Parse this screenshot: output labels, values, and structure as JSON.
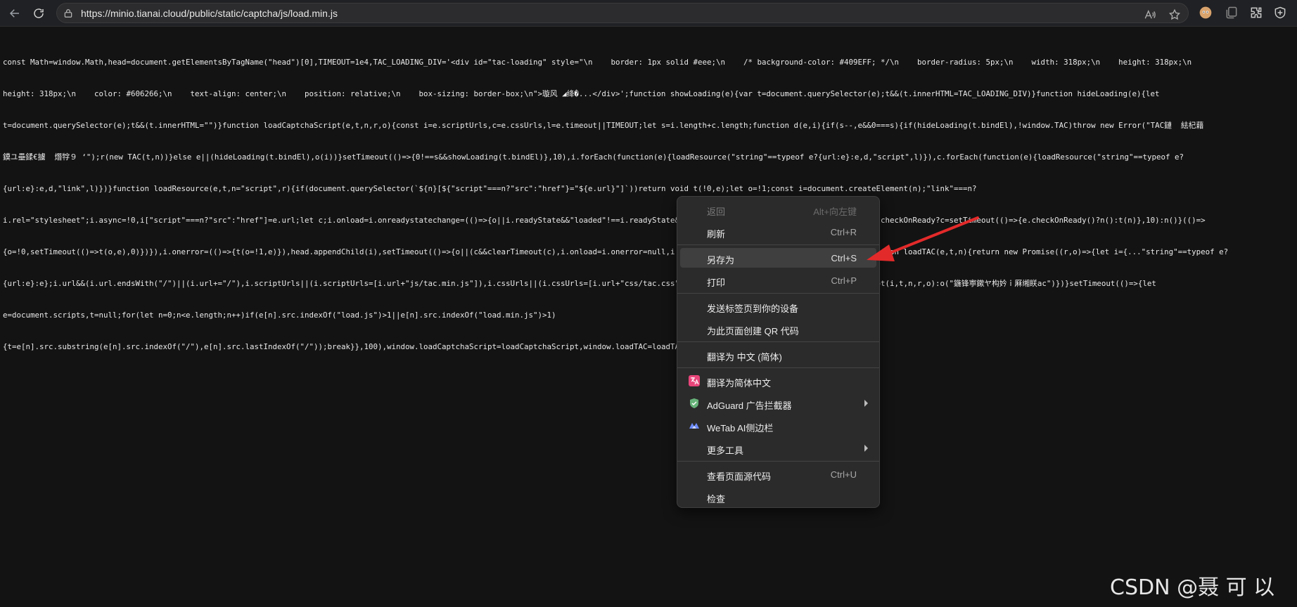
{
  "browser": {
    "url": "https://minio.tianai.cloud/public/static/captcha/js/load.min.js"
  },
  "code_lines": [
    "const Math=window.Math,head=document.getElementsByTagName(\"head\")[0],TIMEOUT=1e4,TAC_LOADING_DIV='<div id=\"tac-loading\" style=\"\\n    border: 1px solid #eee;\\n    /* background-color: #409EFF; */\\n    border-radius: 5px;\\n    width: 318px;\\n    height: 318px;\\n",
    "height: 318px;\\n    color: #606266;\\n    text-align: center;\\n    position: relative;\\n    box-sizing: border-box;\\n\">璇风 ◢绛�...</div>';function showLoading(e){var t=document.querySelector(e);t&&(t.innerHTML=TAC_LOADING_DIV)}function hideLoading(e){let",
    "t=document.querySelector(e);t&&(t.innerHTML=\"\")}function loadCaptchaScript(e,t,n,r,o){const i=e.scriptUrls,c=e.cssUrls,l=e.timeout||TIMEOUT;let s=i.length+c.length;function d(e,i){if(s--,e&&0===s){if(hideLoading(t.bindEl),!window.TAC)throw new Error(\"TAC鏈  紶杞藉",
    "鏌ユ壘鍒€擄  熸牸９ ‘\");r(new TAC(t,n))}else e||(hideLoading(t.bindEl),o(i))}setTimeout(()=>{0!==s&&showLoading(t.bindEl)},10),i.forEach(function(e){loadResource(\"string\"==typeof e?{url:e}:e,d,\"script\",l)}),c.forEach(function(e){loadResource(\"string\"==typeof e?",
    "{url:e}:e,d,\"link\",l)})}function loadResource(e,t,n=\"script\",r){if(document.querySelector(`${n}[${\"script\"===n?\"src\":\"href\"}=\"${e.url}\"]`))return void t(!0,e);let o=!1;const i=document.createElement(n);\"link\"===n?",
    "i.rel=\"stylesheet\";i.async=!0,i[\"script\"===n?\"src\":\"href\"]=e.url;let c;i.onload=i.onreadystatechange=(()=>{o||i.readyState&&\"loaded\"!==i.readyState&&\"complete\"!==i.readyState||function t(n){e.checkOnReady?c=setTimeout(()=>{e.checkOnReady()?n():t(n)},10):n()}(()=>",
    "{o=!0,setTimeout(()=>t(o,e),0)})}),i.onerror=(()=>{t(o=!1,e)}),head.appendChild(i),setTimeout(()=>{o||(c&&clearTimeout(c),i.onload=i.onerror=null,i.remove&&i.remove(),t(o,e))},r||TIMEOUT)}function loadTAC(e,t,n){return new Promise((r,o)=>{let i={...\"string\"==typeof e?",
    "{url:e}:e};i.url&&(i.url.endsWith(\"/\")||(i.url+=\"/\"),i.scriptUrls||(i.scriptUrls=[i.url+\"js/tac.min.js\"]),i.cssUrls||(i.cssUrls=[i.url+\"css/tac.css\"])),i.scriptUrls&&i.cssUrls?loadCaptchaScript(i,t,n,r,o):o(\"鍦锋寕鏉ヤ构妗ｉ厤缃眹ac\")})}setTimeout(()=>{let",
    "e=document.scripts,t=null;for(let n=0;n<e.length;n++)if(e[n].src.indexOf(\"load.js\")>1||e[n].src.indexOf(\"load.min.js\")>1)",
    "{t=e[n].src.substring(e[n].src.indexOf(\"/\"),e[n].src.lastIndexOf(\"/\"));break}},100),window.loadCaptchaScript=loadCaptchaScript,window.loadTAC=loadTAC,window.initTAC=loadTAC;"
  ],
  "menu": {
    "back": {
      "label": "返回",
      "shortcut": "Alt+向左键"
    },
    "refresh": {
      "label": "刷新",
      "shortcut": "Ctrl+R"
    },
    "save_as": {
      "label": "另存为",
      "shortcut": "Ctrl+S"
    },
    "print": {
      "label": "打印",
      "shortcut": "Ctrl+P"
    },
    "send_tab": {
      "label": "发送标签页到你的设备"
    },
    "qr_code": {
      "label": "为此页面创建 QR 代码"
    },
    "translate": {
      "label": "翻译为 中文 (简体)"
    },
    "translate_ext": {
      "label": "翻译为简体中文"
    },
    "adguard": {
      "label": "AdGuard 广告拦截器"
    },
    "wetab": {
      "label": "WeTab AI侧边栏"
    },
    "more_tools": {
      "label": "更多工具"
    },
    "view_source": {
      "label": "查看页面源代码",
      "shortcut": "Ctrl+U"
    },
    "inspect": {
      "label": "检查"
    }
  },
  "watermark": "CSDN @聂 可 以",
  "colors": {
    "arrow": "#e32a2a",
    "adguard_green": "#67b279",
    "translate_pink": "#e8457a",
    "wetab_blue": "#6d8cff"
  }
}
